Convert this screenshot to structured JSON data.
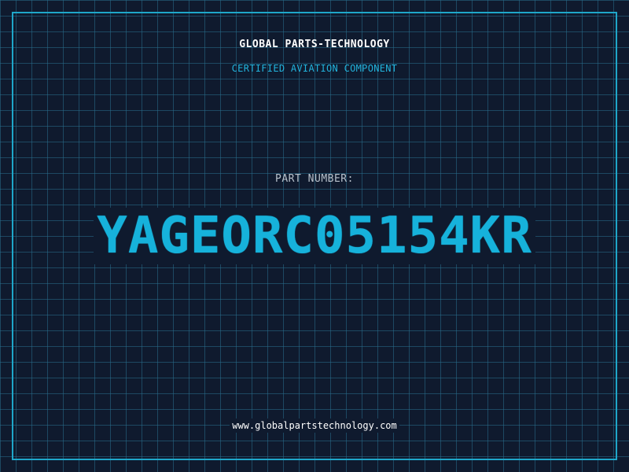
{
  "header": {
    "company": "GLOBAL PARTS-TECHNOLOGY",
    "subtitle": "CERTIFIED AVIATION COMPONENT"
  },
  "part": {
    "label": "PART NUMBER:",
    "number": "YAGEORC05154KR"
  },
  "footer": {
    "url": "www.globalpartstechnology.com"
  },
  "colors": {
    "background": "#0f1a2e",
    "grid": "#286e8c",
    "accent": "#16b2db",
    "frame": "#1fa6c9"
  }
}
